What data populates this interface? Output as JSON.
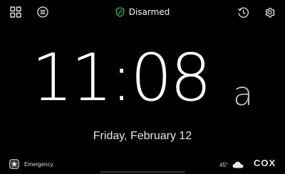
{
  "header": {
    "status": "Disarmed",
    "icons": {
      "apps": "grid-icon",
      "menu": "menu-icon",
      "status": "shield-icon",
      "history": "history-icon",
      "settings": "gear-icon"
    },
    "status_color": "#1fbf5a"
  },
  "clock": {
    "time": "11:08",
    "ampm": "a"
  },
  "date": "Friday, February 12",
  "footer": {
    "emergency_label": "Emergency",
    "temperature": "45°",
    "weather_icon": "cloud-icon",
    "brand": "COX"
  }
}
